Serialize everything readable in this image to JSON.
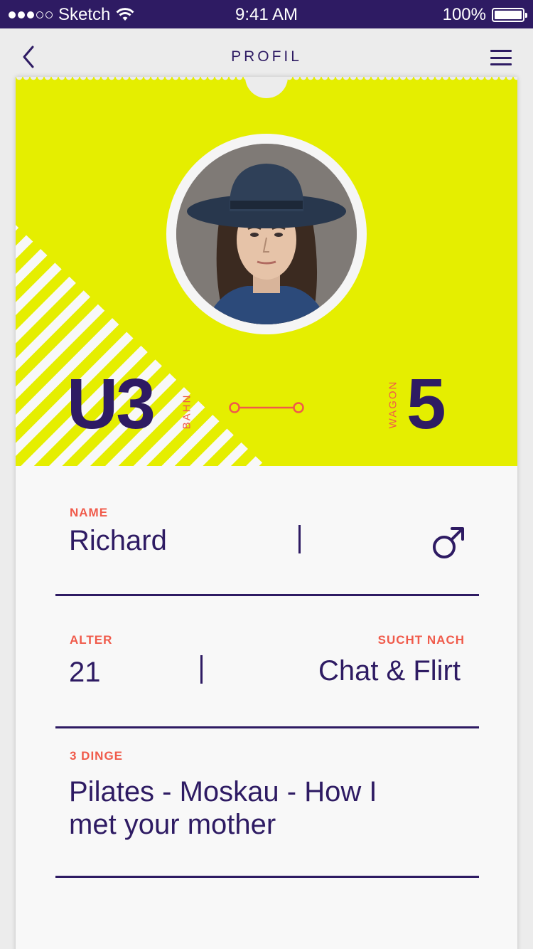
{
  "statusbar": {
    "carrier": "Sketch",
    "time": "9:41 AM",
    "battery": "100%"
  },
  "nav": {
    "title": "PROFIL"
  },
  "ticket": {
    "line_code": "U3",
    "line_label": "BAHN",
    "wagon_label": "WAGON",
    "wagon_number": "5"
  },
  "profile": {
    "name_label": "NAME",
    "name": "Richard",
    "gender_icon": "male-symbol-icon",
    "age_label": "ALTER",
    "age": "21",
    "seeking_label": "SUCHT NACH",
    "seeking": "Chat & Flirt",
    "things_label": "3 DINGE",
    "things_line1": "Pilates - Moskau - How I",
    "things_line2": "met your mother"
  },
  "colors": {
    "primary": "#2e1b63",
    "accent": "#f05a4a",
    "ticket_yellow": "#e5ee00"
  }
}
